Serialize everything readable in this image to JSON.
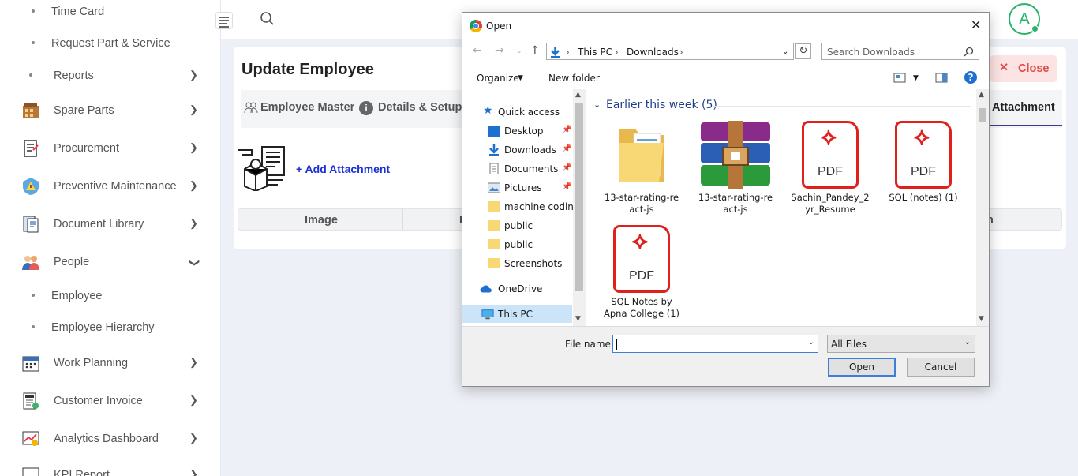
{
  "sidebar": {
    "sub_items": [
      "Time Card",
      "Request Part & Service",
      "Reports"
    ],
    "items": [
      {
        "label": "Spare Parts",
        "icon": "spare-parts-icon"
      },
      {
        "label": "Procurement",
        "icon": "procurement-icon"
      },
      {
        "label": "Preventive Maintenance",
        "icon": "warning-icon"
      },
      {
        "label": "Document Library",
        "icon": "document-library-icon"
      },
      {
        "label": "People",
        "icon": "people-icon"
      }
    ],
    "people_children": [
      "Employee",
      "Employee Hierarchy"
    ],
    "items2": [
      {
        "label": "Work Planning",
        "icon": "calendar-icon"
      },
      {
        "label": "Customer Invoice",
        "icon": "invoice-icon"
      },
      {
        "label": "Analytics Dashboard",
        "icon": "analytics-icon"
      },
      {
        "label": "KPI Report",
        "icon": "kpi-icon"
      }
    ]
  },
  "topbar": {
    "avatar_letter": "A"
  },
  "page": {
    "title": "Update Employee",
    "tabs": [
      "Employee Master",
      "Details & Setup",
      "Attachment"
    ],
    "active_tab": "Attachment",
    "close_label": "Close",
    "close_x": "✕",
    "add_attachment": "+ Add Attachment",
    "table_headers": [
      "Image",
      "F",
      "n"
    ]
  },
  "dialog": {
    "title": "Open",
    "path": [
      "This PC",
      "Downloads"
    ],
    "search_placeholder": "Search Downloads",
    "organize": "Organize",
    "new_folder": "New folder",
    "nav_tree": [
      {
        "label": "Quick access",
        "icon": "star-icon"
      },
      {
        "label": "Desktop",
        "icon": "desktop-icon",
        "pinned": true
      },
      {
        "label": "Downloads",
        "icon": "download-icon",
        "pinned": true
      },
      {
        "label": "Documents",
        "icon": "documents-icon",
        "pinned": true
      },
      {
        "label": "Pictures",
        "icon": "pictures-icon",
        "pinned": true
      },
      {
        "label": "machine coding",
        "icon": "folder-icon"
      },
      {
        "label": "public",
        "icon": "folder-icon"
      },
      {
        "label": "public",
        "icon": "folder-icon"
      },
      {
        "label": "Screenshots",
        "icon": "folder-icon"
      },
      {
        "label": "OneDrive",
        "icon": "cloud-icon"
      },
      {
        "label": "This PC",
        "icon": "computer-icon",
        "selected": true
      }
    ],
    "group_header": "Earlier this week (5)",
    "files": [
      {
        "name": "13-star-rating-react-js",
        "name_lines": [
          "13-star-rating-re",
          "act-js"
        ],
        "type": "folder"
      },
      {
        "name": "13-star-rating-react-js",
        "name_lines": [
          "13-star-rating-re",
          "act-js"
        ],
        "type": "winrar"
      },
      {
        "name": "Sachin_Pandey_2yr_Resume",
        "name_lines": [
          "Sachin_Pandey_2",
          "yr_Resume"
        ],
        "type": "pdf"
      },
      {
        "name": "SQL (notes) (1)",
        "name_lines": [
          "SQL (notes) (1)"
        ],
        "type": "pdf"
      },
      {
        "name": "SQL Notes by Apna College (1)",
        "name_lines": [
          "SQL Notes by",
          "Apna College (1)"
        ],
        "type": "pdf"
      }
    ],
    "pdf_label": "PDF",
    "file_name_label": "File name:",
    "file_name_value": "",
    "file_type": "All Files",
    "open_button": "Open",
    "cancel_button": "Cancel"
  },
  "colors": {
    "accent": "#1b2fd6",
    "close_bg": "#fde4e4",
    "close_fg": "#e04b4b",
    "avatar": "#29b36a",
    "pdf_red": "#e0201b"
  }
}
